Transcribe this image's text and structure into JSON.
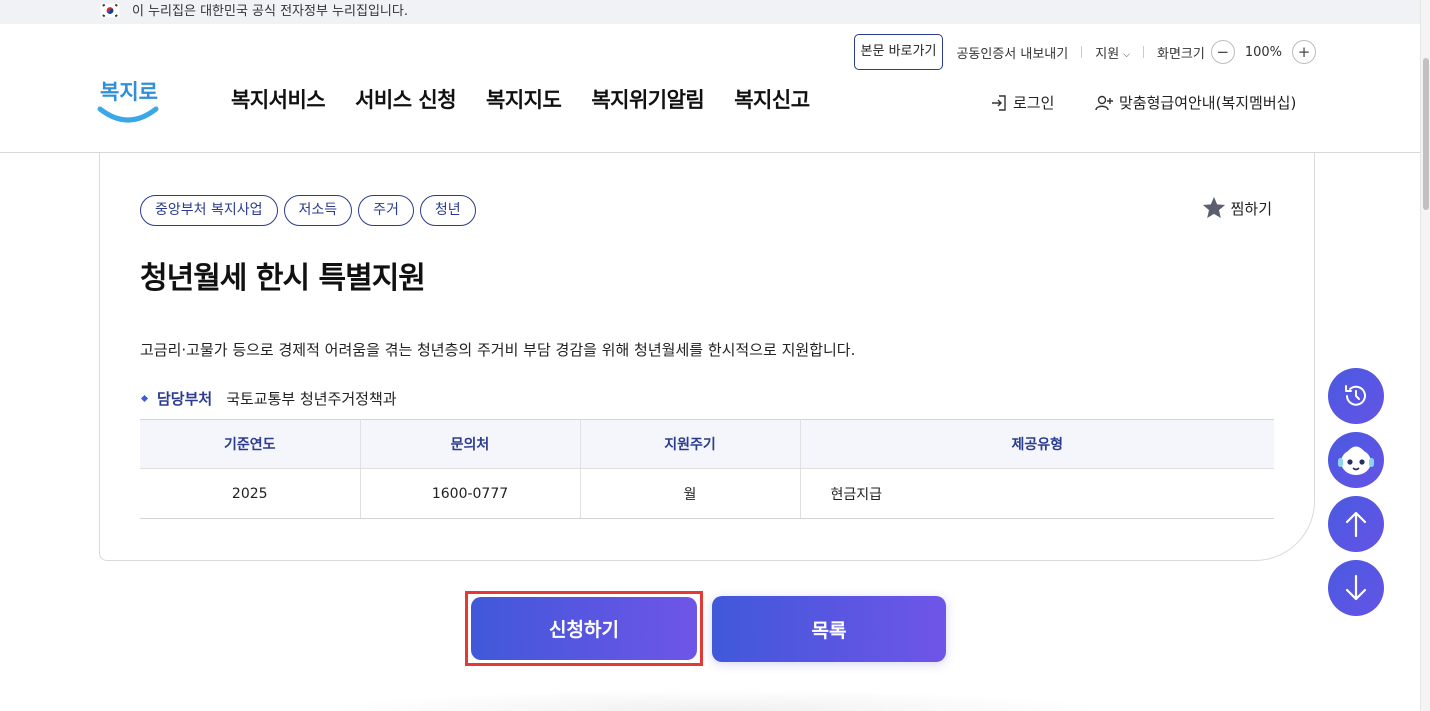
{
  "gov_banner": {
    "text": "이 누리집은 대한민국 공식 전자정부 누리집입니다."
  },
  "util_menu": {
    "skip": "본문 바로가기",
    "cert": "공동인증서 내보내기",
    "support": "지원",
    "screen_size": "화면크기",
    "zoom_minus": "−",
    "zoom_value": "100%",
    "zoom_plus": "+"
  },
  "logo": {
    "text": "복지로"
  },
  "nav": {
    "items": [
      "복지서비스",
      "서비스 신청",
      "복지지도",
      "복지위기알림",
      "복지신고"
    ]
  },
  "account": {
    "login": "로그인",
    "membership": "맞춤형급여안내(복지멤버십)"
  },
  "service": {
    "tags": [
      "중앙부처 복지사업",
      "저소득",
      "주거",
      "청년"
    ],
    "favorite": "찜하기",
    "title": "청년월세 한시 특별지원",
    "description": "고금리·고물가 등으로 경제적 어려움을 겪는 청년층의 주거비 부담 경감을 위해 청년월세를 한시적으로 지원합니다.",
    "dept_label": "담당부처",
    "dept_value": "국토교통부 청년주거정책과"
  },
  "info_table": {
    "headers": [
      "기준연도",
      "문의처",
      "지원주기",
      "제공유형"
    ],
    "row": [
      "2025",
      "1600-0777",
      "월",
      "현금지급"
    ]
  },
  "actions": {
    "apply": "신청하기",
    "list": "목록"
  },
  "colors": {
    "brand_navy": "#2b3b8f",
    "accent_start": "#4058d9",
    "accent_end": "#6f55e8",
    "highlight_red": "#e53935"
  }
}
